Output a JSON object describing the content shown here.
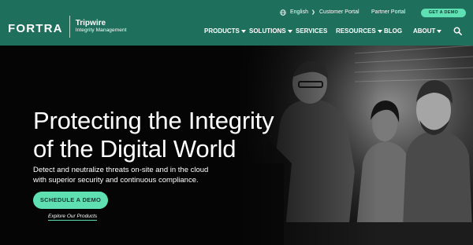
{
  "header": {
    "logo": {
      "brand": "FORTRA",
      "product_line1": "Tripwire",
      "product_line2": "Integrity Management"
    },
    "utility": {
      "language": "English",
      "customer_portal": "Customer Portal",
      "partner_portal": "Partner Portal",
      "demo_button": "GET A DEMO"
    },
    "nav": [
      {
        "label": "PRODUCTS",
        "has_dropdown": true
      },
      {
        "label": "SOLUTIONS",
        "has_dropdown": true
      },
      {
        "label": "SERVICES",
        "has_dropdown": false
      },
      {
        "label": "RESOURCES",
        "has_dropdown": true
      },
      {
        "label": "BLOG",
        "has_dropdown": false
      },
      {
        "label": "ABOUT",
        "has_dropdown": true
      }
    ],
    "search_icon": "search-icon"
  },
  "hero": {
    "title_line1": "Protecting the Integrity",
    "title_line2": "of the Digital World",
    "subtitle_line1": "Detect and neutralize threats on-site and in the cloud",
    "subtitle_line2": "with superior security and continuous compliance.",
    "cta": "SCHEDULE A DEMO",
    "secondary_link": "Explore Our Products"
  },
  "colors": {
    "header_bg": "#1e6f5c",
    "accent": "#5fe0b3",
    "hero_bg": "#050505"
  }
}
